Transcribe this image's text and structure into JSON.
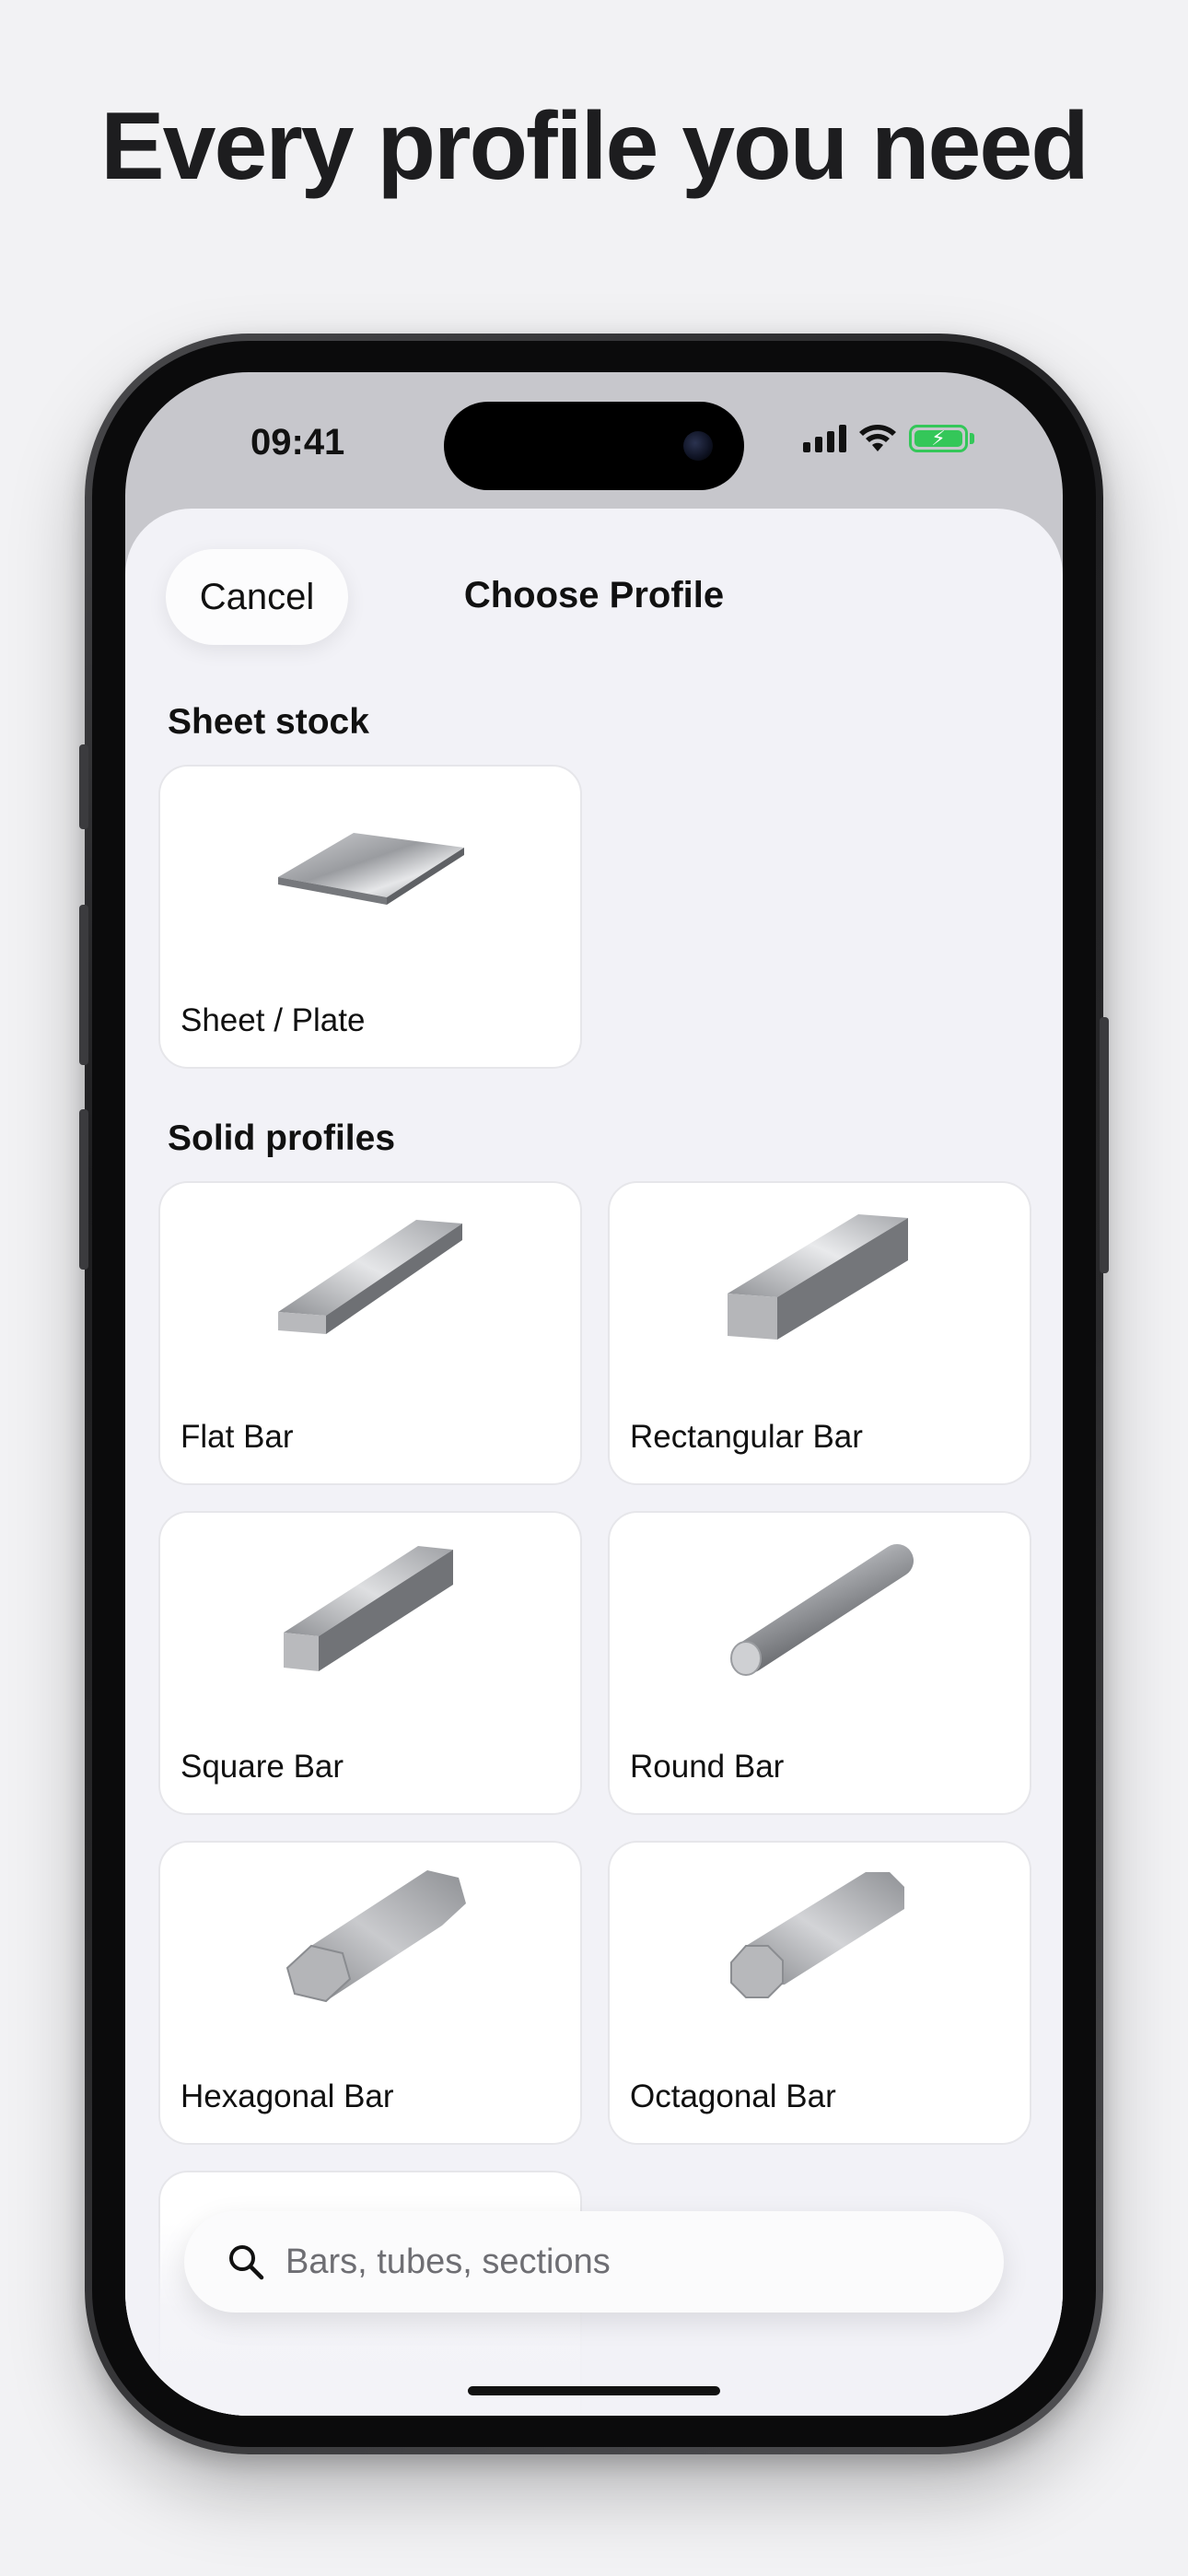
{
  "headline": "Every profile you need",
  "status_bar": {
    "time": "09:41"
  },
  "nav": {
    "cancel_label": "Cancel",
    "title": "Choose Profile"
  },
  "sections": [
    {
      "title": "Sheet stock",
      "items": [
        {
          "label": "Sheet / Plate"
        }
      ]
    },
    {
      "title": "Solid profiles",
      "items": [
        {
          "label": "Flat Bar"
        },
        {
          "label": "Rectangular Bar"
        },
        {
          "label": "Square Bar"
        },
        {
          "label": "Round Bar"
        },
        {
          "label": "Hexagonal Bar"
        },
        {
          "label": "Octagonal Bar"
        }
      ]
    }
  ],
  "search": {
    "placeholder": "Bars, tubes, sections",
    "value": ""
  },
  "colors": {
    "battery": "#34c759",
    "background": "#f2f2f4",
    "sheet": "#f2f2f7"
  }
}
